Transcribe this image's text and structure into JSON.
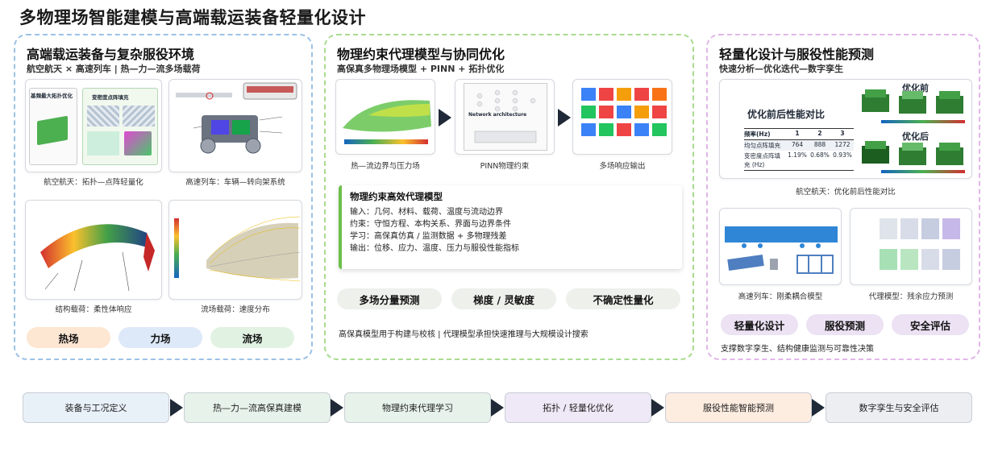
{
  "title": "多物理场智能建模与高端载运装备轻量化设计",
  "panel1": {
    "title": "高端载运装备与复杂服役环境",
    "subtitle": "航空航天 × 高速列车 | 热—力—流多场载荷",
    "img1_caption": "航空航天：拓扑—点阵轻量化",
    "img1_label_a": "基頻最大拓扑优化",
    "img1_label_b": "变密度点阵填充",
    "img2_caption": "高速列车：车辆—转向架系统",
    "img3_caption": "结构载荷：柔性体响应",
    "img4_caption": "流场载荷：速度分布",
    "pills": [
      "热场",
      "力场",
      "流场"
    ]
  },
  "panel2": {
    "title": "物理约束代理模型与协同优化",
    "subtitle": "高保真多物理场模型 + PINN + 拓扑优化",
    "img1_caption": "热—流边界与压力场",
    "img2_caption": "PINN物理约束",
    "img2_label": "Network architecture",
    "img3_caption": "多场响应输出",
    "box_title": "物理约束高效代理模型",
    "box_lines": [
      "输入：几何、材料、载荷、温度与流动边界",
      "约束：守恒方程、本构关系、界面与边界条件",
      "学习：高保真仿真 / 监测数据 + 多物理残差",
      "输出：位移、应力、温度、压力与服役性能指标"
    ],
    "pills": [
      "多场分量预测",
      "梯度 / 灵敏度",
      "不确定性量化"
    ],
    "note": "高保真模型用于构建与校核 | 代理模型承担快速推理与大规模设计搜索"
  },
  "panel3": {
    "title": "轻量化设计与服役性能预测",
    "subtitle": "快速分析—优化迭代—数字孪生",
    "table_title": "优化前后性能对比",
    "before_label": "优化前",
    "after_label": "优化后",
    "table": {
      "header": [
        "频率(Hz)",
        "1",
        "2",
        "3"
      ],
      "rows": [
        [
          "均匀点阵填充",
          "764",
          "888",
          "1272"
        ],
        [
          "变密度点阵填充 (Hz)",
          "1.19%",
          "0.68%",
          "0.93%"
        ]
      ]
    },
    "img1_caption": "航空航天：优化前后性能对比",
    "img2_caption": "高速列车：刚柔耦合模型",
    "img3_caption": "代理模型：残余应力预测",
    "pills": [
      "轻量化设计",
      "服役预测",
      "安全评估"
    ],
    "note": "支撑数字孪生、结构健康监测与可靠性决策"
  },
  "flow": [
    "装备与工况定义",
    "热—力—流高保真建模",
    "物理约束代理学习",
    "拓扑 / 轻量化优化",
    "服役性能智能预测",
    "数字孪生与安全评估"
  ],
  "colors": {
    "blue_border": "#9cc2e6",
    "green_border": "#a8dc8e",
    "purple_border": "#e2b6ea",
    "pill_orange": "#fde6d2",
    "pill_blue": "#dde9f8",
    "pill_green": "#e1f2e3",
    "pill_gray": "#eef0ec",
    "pill_purple": "#ece2f4"
  }
}
